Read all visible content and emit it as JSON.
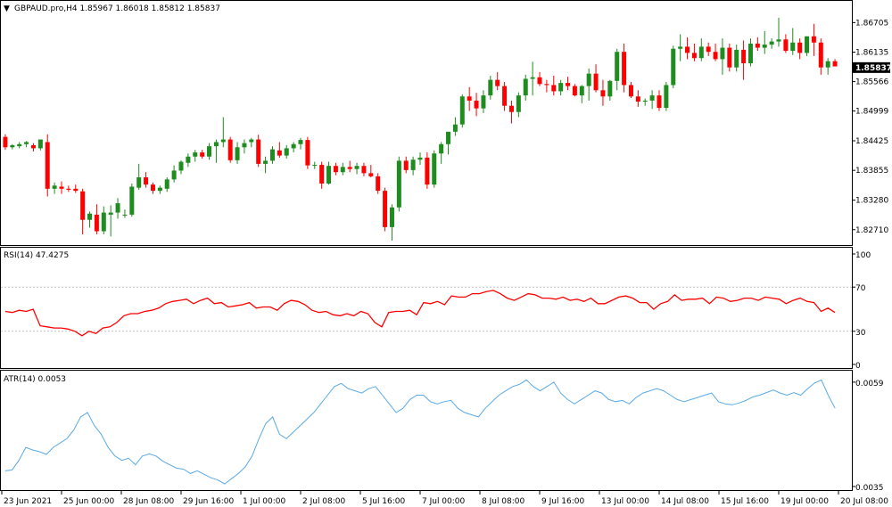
{
  "header": {
    "menu_icon": "triangle-down-icon",
    "title": "GBPAUD.pro,H4 1.85967 1.86018 1.85812 1.85837"
  },
  "colors": {
    "bull": "#1e8c1e",
    "bear": "#ff0000",
    "rsi_line": "#ff0000",
    "atr_line": "#5aaae6",
    "level_line": "#c0c0c0",
    "border": "#000000",
    "price_tag_bg": "#000000"
  },
  "chart_data": [
    {
      "type": "candlestick",
      "name": "GBPAUD.pro,H4",
      "y_ticks": [
        "1.86705",
        "1.86135",
        "1.85566",
        "1.84999",
        "1.84425",
        "1.83855",
        "1.83280",
        "1.82710"
      ],
      "current_price": "1.85837",
      "ylim": [
        1.825,
        1.869
      ],
      "candles": [
        [
          1.845,
          1.8455,
          1.8425,
          1.843
        ],
        [
          1.843,
          1.8436,
          1.8426,
          1.8434
        ],
        [
          1.8432,
          1.844,
          1.8428,
          1.8436
        ],
        [
          1.8436,
          1.8442,
          1.843,
          1.844
        ],
        [
          1.8434,
          1.8438,
          1.8422,
          1.8428
        ],
        [
          1.8428,
          1.844,
          1.8424,
          1.8445
        ],
        [
          1.844,
          1.8455,
          1.8335,
          1.835
        ],
        [
          1.835,
          1.8362,
          1.834,
          1.8356
        ],
        [
          1.8354,
          1.8364,
          1.834,
          1.835
        ],
        [
          1.835,
          1.8356,
          1.8344,
          1.8348
        ],
        [
          1.835,
          1.8358,
          1.8342,
          1.8346
        ],
        [
          1.8345,
          1.835,
          1.8262,
          1.829
        ],
        [
          1.829,
          1.8306,
          1.8275,
          1.8302
        ],
        [
          1.83,
          1.832,
          1.8262,
          1.8268
        ],
        [
          1.8268,
          1.8316,
          1.8262,
          1.8304
        ],
        [
          1.83,
          1.8318,
          1.8258,
          1.8304
        ],
        [
          1.8304,
          1.8332,
          1.8292,
          1.8322
        ],
        [
          1.83,
          1.831,
          1.8294,
          1.83
        ],
        [
          1.83,
          1.836,
          1.8296,
          1.8354
        ],
        [
          1.8352,
          1.8398,
          1.8348,
          1.8372
        ],
        [
          1.8372,
          1.8382,
          1.8352,
          1.8358
        ],
        [
          1.8358,
          1.8362,
          1.834,
          1.8346
        ],
        [
          1.8346,
          1.8356,
          1.834,
          1.8352
        ],
        [
          1.835,
          1.8372,
          1.8344,
          1.8368
        ],
        [
          1.8368,
          1.8395,
          1.8362,
          1.8385
        ],
        [
          1.8385,
          1.8405,
          1.8378,
          1.8402
        ],
        [
          1.84,
          1.8418,
          1.8392,
          1.8412
        ],
        [
          1.8412,
          1.8425,
          1.8402,
          1.842
        ],
        [
          1.842,
          1.8425,
          1.8408,
          1.8412
        ],
        [
          1.8412,
          1.8438,
          1.8406,
          1.8432
        ],
        [
          1.8432,
          1.8445,
          1.84,
          1.844
        ],
        [
          1.844,
          1.8488,
          1.843,
          1.8445
        ],
        [
          1.8445,
          1.845,
          1.84,
          1.8405
        ],
        [
          1.8405,
          1.844,
          1.8398,
          1.843
        ],
        [
          1.843,
          1.8445,
          1.8418,
          1.8438
        ],
        [
          1.844,
          1.8448,
          1.843,
          1.8445
        ],
        [
          1.8445,
          1.8454,
          1.8392,
          1.8398
        ],
        [
          1.8398,
          1.8412,
          1.838,
          1.8404
        ],
        [
          1.8404,
          1.8432,
          1.8398,
          1.8426
        ],
        [
          1.8424,
          1.844,
          1.841,
          1.8414
        ],
        [
          1.8414,
          1.8434,
          1.8408,
          1.8428
        ],
        [
          1.8428,
          1.844,
          1.842,
          1.8436
        ],
        [
          1.8436,
          1.8448,
          1.8426,
          1.8444
        ],
        [
          1.8444,
          1.845,
          1.8388,
          1.8395
        ],
        [
          1.8395,
          1.8402,
          1.8388,
          1.8396
        ],
        [
          1.8396,
          1.8402,
          1.835,
          1.836
        ],
        [
          1.836,
          1.8402,
          1.8358,
          1.8394
        ],
        [
          1.8394,
          1.84,
          1.8376,
          1.8382
        ],
        [
          1.8382,
          1.84,
          1.8376,
          1.8392
        ],
        [
          1.8392,
          1.8404,
          1.8382,
          1.8388
        ],
        [
          1.8388,
          1.84,
          1.8378,
          1.8394
        ],
        [
          1.8394,
          1.84,
          1.8374,
          1.838
        ],
        [
          1.838,
          1.8396,
          1.8372,
          1.8374
        ],
        [
          1.8374,
          1.838,
          1.834,
          1.8346
        ],
        [
          1.8346,
          1.8352,
          1.8268,
          1.8276
        ],
        [
          1.8276,
          1.832,
          1.825,
          1.8314
        ],
        [
          1.8314,
          1.8412,
          1.8306,
          1.8404
        ],
        [
          1.8404,
          1.8412,
          1.838,
          1.8386
        ],
        [
          1.8386,
          1.8412,
          1.8376,
          1.8406
        ],
        [
          1.8406,
          1.842,
          1.8396,
          1.841
        ],
        [
          1.841,
          1.842,
          1.835,
          1.8358
        ],
        [
          1.8358,
          1.8424,
          1.8352,
          1.8418
        ],
        [
          1.8418,
          1.844,
          1.8398,
          1.8436
        ],
        [
          1.8436,
          1.8452,
          1.8416,
          1.846
        ],
        [
          1.846,
          1.8488,
          1.8452,
          1.8474
        ],
        [
          1.8474,
          1.8532,
          1.8468,
          1.8528
        ],
        [
          1.8528,
          1.8546,
          1.85,
          1.852
        ],
        [
          1.852,
          1.8535,
          1.849,
          1.8505
        ],
        [
          1.8505,
          1.854,
          1.8496,
          1.853
        ],
        [
          1.853,
          1.8568,
          1.8522,
          1.856
        ],
        [
          1.856,
          1.8575,
          1.854,
          1.8548
        ],
        [
          1.8548,
          1.8556,
          1.85,
          1.851
        ],
        [
          1.851,
          1.852,
          1.8476,
          1.8498
        ],
        [
          1.8498,
          1.8536,
          1.8488,
          1.853
        ],
        [
          1.853,
          1.857,
          1.852,
          1.8562
        ],
        [
          1.8562,
          1.8595,
          1.853,
          1.8565
        ],
        [
          1.8565,
          1.8575,
          1.8548,
          1.8552
        ],
        [
          1.8552,
          1.856,
          1.8536,
          1.855
        ],
        [
          1.855,
          1.8568,
          1.853,
          1.8538
        ],
        [
          1.8538,
          1.856,
          1.853,
          1.8554
        ],
        [
          1.8554,
          1.8566,
          1.854,
          1.8548
        ],
        [
          1.8548,
          1.8552,
          1.8528,
          1.853
        ],
        [
          1.853,
          1.855,
          1.8515,
          1.8548
        ],
        [
          1.8548,
          1.8582,
          1.852,
          1.8572
        ],
        [
          1.8572,
          1.859,
          1.8536,
          1.854
        ],
        [
          1.854,
          1.856,
          1.851,
          1.8528
        ],
        [
          1.8528,
          1.856,
          1.852,
          1.8558
        ],
        [
          1.8558,
          1.862,
          1.854,
          1.8614
        ],
        [
          1.8614,
          1.863,
          1.8536,
          1.855
        ],
        [
          1.855,
          1.8556,
          1.8525,
          1.8528
        ],
        [
          1.8528,
          1.854,
          1.8508,
          1.8518
        ],
        [
          1.8518,
          1.8524,
          1.851,
          1.852
        ],
        [
          1.852,
          1.854,
          1.8504,
          1.853
        ],
        [
          1.853,
          1.854,
          1.85,
          1.8506
        ],
        [
          1.8506,
          1.8556,
          1.85,
          1.855
        ],
        [
          1.855,
          1.8626,
          1.8544,
          1.862
        ],
        [
          1.862,
          1.8648,
          1.8596,
          1.8624
        ],
        [
          1.8624,
          1.8642,
          1.86,
          1.8612
        ],
        [
          1.8612,
          1.863,
          1.8596,
          1.8602
        ],
        [
          1.8602,
          1.864,
          1.8596,
          1.8624
        ],
        [
          1.8624,
          1.8632,
          1.8606,
          1.8614
        ],
        [
          1.8614,
          1.863,
          1.8596,
          1.86
        ],
        [
          1.86,
          1.864,
          1.857,
          1.8622
        ],
        [
          1.8622,
          1.863,
          1.8576,
          1.8584
        ],
        [
          1.8584,
          1.8628,
          1.8576,
          1.8618
        ],
        [
          1.8618,
          1.8636,
          1.856,
          1.8592
        ],
        [
          1.8592,
          1.864,
          1.8586,
          1.863
        ],
        [
          1.863,
          1.8642,
          1.8616,
          1.8622
        ],
        [
          1.8622,
          1.8654,
          1.861,
          1.8628
        ],
        [
          1.8628,
          1.864,
          1.862,
          1.8634
        ],
        [
          1.8634,
          1.868,
          1.8624,
          1.8638
        ],
        [
          1.8638,
          1.8648,
          1.8612,
          1.8616
        ],
        [
          1.8616,
          1.866,
          1.8608,
          1.8632
        ],
        [
          1.8632,
          1.864,
          1.86,
          1.8612
        ],
        [
          1.8612,
          1.8644,
          1.8606,
          1.8644
        ],
        [
          1.8644,
          1.8668,
          1.8606,
          1.8632
        ],
        [
          1.8632,
          1.864,
          1.857,
          1.8584
        ],
        [
          1.8584,
          1.8602,
          1.857,
          1.8596
        ],
        [
          1.8596,
          1.86,
          1.859,
          1.8586
        ]
      ]
    },
    {
      "type": "line",
      "name": "RSI(14)",
      "title": "RSI(14) 47.4275",
      "y_ticks": [
        "100",
        "70",
        "30",
        "0"
      ],
      "levels": [
        70,
        30
      ],
      "ylim": [
        0,
        100
      ],
      "values": [
        48,
        47,
        49,
        48,
        50,
        35,
        34,
        33,
        33,
        32,
        30,
        26,
        30,
        28,
        33,
        34,
        38,
        44,
        46,
        46,
        48,
        49,
        51,
        55,
        57,
        58,
        59,
        55,
        58,
        60,
        55,
        56,
        52,
        53,
        54,
        56,
        51,
        52,
        52,
        49,
        55,
        58,
        57,
        54,
        49,
        47,
        48,
        45,
        44,
        46,
        44,
        48,
        46,
        38,
        34,
        47,
        48,
        48,
        49,
        45,
        56,
        55,
        57,
        54,
        62,
        61,
        61,
        64,
        64,
        66,
        67,
        64,
        60,
        58,
        61,
        64,
        63,
        60,
        60,
        59,
        61,
        58,
        59,
        57,
        60,
        55,
        55,
        58,
        61,
        62,
        60,
        56,
        56,
        50,
        55,
        57,
        63,
        58,
        59,
        59,
        60,
        55,
        61,
        60,
        57,
        58,
        60,
        60,
        58,
        61,
        60,
        59,
        55,
        58,
        60,
        57,
        56,
        48,
        51,
        47
      ]
    },
    {
      "type": "line",
      "name": "ATR(14)",
      "title": "ATR(14) 0.0053",
      "y_ticks": [
        "0.0059",
        "0.0035"
      ],
      "ylim": [
        0.0035,
        0.006
      ],
      "values": [
        0.00386,
        0.00388,
        0.0041,
        0.0044,
        0.00434,
        0.0043,
        0.00424,
        0.0044,
        0.0045,
        0.0046,
        0.0048,
        0.0051,
        0.0052,
        0.0049,
        0.0047,
        0.0044,
        0.0042,
        0.0041,
        0.00415,
        0.004,
        0.0042,
        0.00425,
        0.0042,
        0.00408,
        0.004,
        0.00392,
        0.0039,
        0.0038,
        0.00386,
        0.00378,
        0.0037,
        0.00365,
        0.00356,
        0.00368,
        0.0038,
        0.00395,
        0.0042,
        0.0046,
        0.00495,
        0.0051,
        0.0047,
        0.0046,
        0.00475,
        0.0049,
        0.00505,
        0.0052,
        0.0054,
        0.0056,
        0.0058,
        0.00587,
        0.00575,
        0.0057,
        0.00565,
        0.00575,
        0.0058,
        0.0056,
        0.0054,
        0.0052,
        0.0053,
        0.0055,
        0.0056,
        0.0056,
        0.00545,
        0.0054,
        0.00545,
        0.00548,
        0.0053,
        0.0052,
        0.00515,
        0.0051,
        0.0053,
        0.00545,
        0.0056,
        0.0057,
        0.0058,
        0.00585,
        0.00595,
        0.0058,
        0.0057,
        0.0058,
        0.0059,
        0.00565,
        0.0055,
        0.0054,
        0.0055,
        0.0056,
        0.0057,
        0.00565,
        0.0055,
        0.00545,
        0.00548,
        0.0054,
        0.00555,
        0.00565,
        0.0057,
        0.00575,
        0.0057,
        0.0056,
        0.0055,
        0.00545,
        0.0055,
        0.00555,
        0.0056,
        0.00565,
        0.00545,
        0.0054,
        0.00538,
        0.00542,
        0.00548,
        0.00556,
        0.0056,
        0.00566,
        0.00572,
        0.00565,
        0.0056,
        0.00566,
        0.0056,
        0.00575,
        0.00588,
        0.00595,
        0.0056,
        0.0053
      ]
    }
  ],
  "x_axis": {
    "labels": [
      "23 Jun 2021",
      "25 Jun 00:00",
      "28 Jun 08:00",
      "29 Jun 16:00",
      "1 Jul 00:00",
      "2 Jul 08:00",
      "5 Jul 16:00",
      "7 Jul 00:00",
      "8 Jul 08:00",
      "9 Jul 16:00",
      "13 Jul 00:00",
      "14 Jul 08:00",
      "15 Jul 16:00",
      "19 Jul 00:00",
      "20 Jul 08:00"
    ]
  }
}
